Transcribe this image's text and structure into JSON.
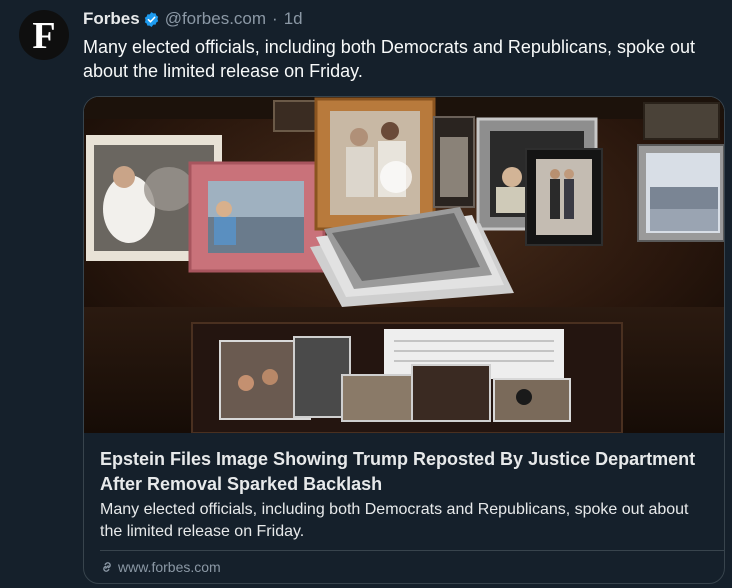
{
  "post": {
    "author_name": "Forbes",
    "handle": "@forbes.com",
    "separator": "·",
    "time": "1d",
    "text": "Many elected officials, including both Democrats and Republicans, spoke out about the limited release on Friday.",
    "avatar_letter": "F",
    "verified_icon": "verified-badge-icon"
  },
  "card": {
    "title": "Epstein Files Image Showing Trump Reposted By Justice Department After Removal Sparked Backlash",
    "description": "Many elected officials, including both Democrats and Republicans, spoke out about the limited release on Friday.",
    "domain": "www.forbes.com",
    "domain_icon": "link-icon"
  },
  "colors": {
    "background": "#15202b",
    "verified": "#1d9bf0",
    "secondary_text": "#8b98a5",
    "border": "#38444d"
  }
}
